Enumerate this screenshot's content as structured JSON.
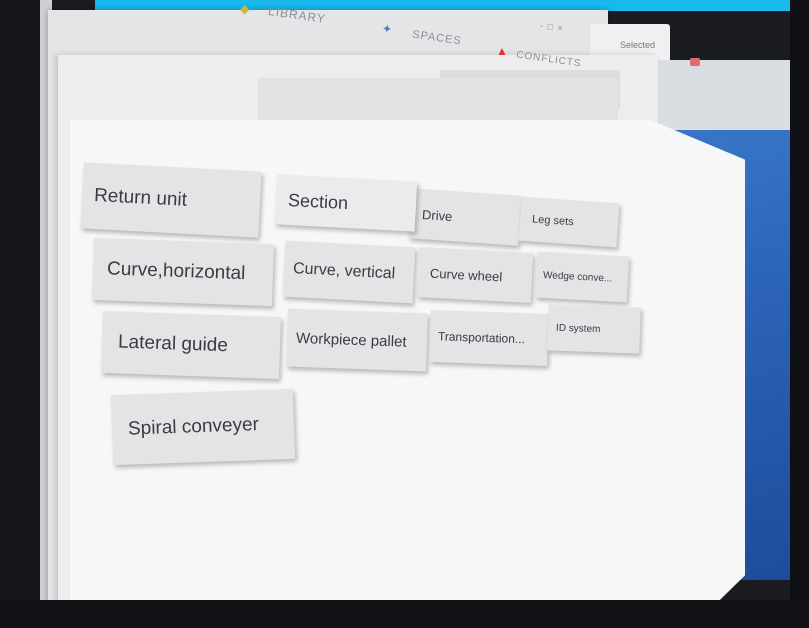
{
  "nav": {
    "library": "LIBRARY",
    "spaces": "SPACES",
    "conflicts": "CONFLICTS",
    "win_tab": "Selected",
    "win_controls": "- □ ×"
  },
  "tiles": {
    "return_unit": "Return unit",
    "section": "Section",
    "drive": "Drive",
    "leg_sets": "Leg sets",
    "curve_horizontal": "Curve,horizontal",
    "curve_vertical": "Curve, vertical",
    "curve_wheel": "Curve wheel",
    "wedge": "Wedge conve...",
    "lateral_guide": "Lateral guide",
    "workpiece_pallet": "Workpiece pallet",
    "transportation": "Transportation...",
    "id_system": "ID system",
    "spiral_conveyer": "Spiral conveyer"
  },
  "colors": {
    "accent": "#19b9ec",
    "desktop": "#2c64b8",
    "warning": "#e0352b"
  }
}
